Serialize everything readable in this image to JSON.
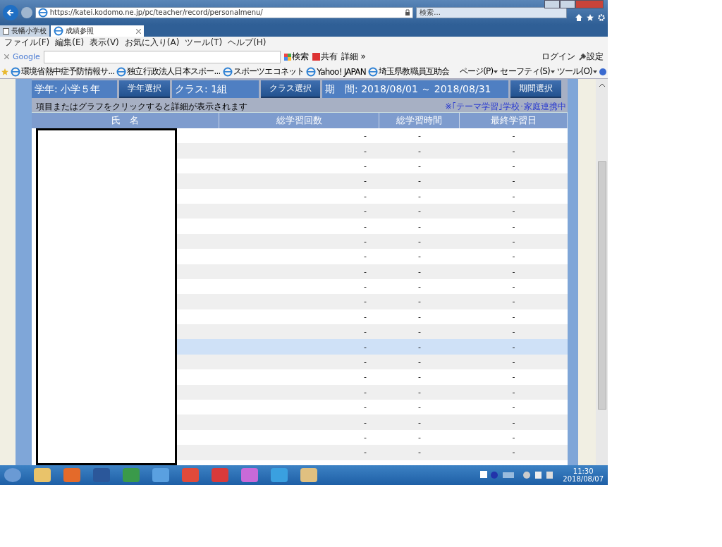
{
  "browser": {
    "address": "https://katei.kodomo.ne.jp/pc/teacher/record/personalmenu/",
    "search": {
      "placeholder": "検索..."
    },
    "tabs": [
      {
        "label": "長幡小学校",
        "selected": false
      },
      {
        "label": "成績参照",
        "selected": true
      }
    ],
    "menu": [
      "ファイル(F)",
      "編集(E)",
      "表示(V)",
      "お気に入り(A)",
      "ツール(T)",
      "ヘルプ(H)"
    ],
    "google_toolbar": {
      "logo": "Google",
      "search": "検索",
      "share": "共有",
      "more": "詳細 »",
      "login": "ログイン",
      "settings": "設定"
    },
    "favorites": [
      "環境省熱中症予防情報サ...",
      "独立行政法人日本スポー...",
      "スポーツエコネット",
      "Yahoo! JAPAN",
      "埼玉県教職員互助会"
    ],
    "command_bar": [
      "ページ(P)",
      "セーフティ(S)",
      "ツール(O)"
    ]
  },
  "page": {
    "grade": "学年: 小学５年",
    "grade_button": "学年選択",
    "class": "クラス: 1組",
    "class_button": "クラス選択",
    "period": "期　間: 2018/08/01 ～ 2018/08/31",
    "period_button": "期間選択",
    "hint": "項目またはグラフをクリックすると詳細が表示されます",
    "notice": "※｢テーマ学習｣学校･家庭連携中",
    "table": {
      "columns": [
        "氏　名",
        "総学習回数",
        "総学習時間",
        "最終学習日"
      ],
      "rows": [
        {
          "count": "-",
          "time": "-",
          "last": "-",
          "selected": false
        },
        {
          "count": "-",
          "time": "-",
          "last": "-",
          "selected": false
        },
        {
          "count": "-",
          "time": "-",
          "last": "-",
          "selected": false
        },
        {
          "count": "-",
          "time": "-",
          "last": "-",
          "selected": false
        },
        {
          "count": "-",
          "time": "-",
          "last": "-",
          "selected": false
        },
        {
          "count": "-",
          "time": "-",
          "last": "-",
          "selected": false
        },
        {
          "count": "-",
          "time": "-",
          "last": "-",
          "selected": false
        },
        {
          "count": "-",
          "time": "-",
          "last": "-",
          "selected": false
        },
        {
          "count": "-",
          "time": "-",
          "last": "-",
          "selected": false
        },
        {
          "count": "-",
          "time": "-",
          "last": "-",
          "selected": false
        },
        {
          "count": "-",
          "time": "-",
          "last": "-",
          "selected": false
        },
        {
          "count": "-",
          "time": "-",
          "last": "-",
          "selected": false
        },
        {
          "count": "-",
          "time": "-",
          "last": "-",
          "selected": false
        },
        {
          "count": "-",
          "time": "-",
          "last": "-",
          "selected": false
        },
        {
          "count": "-",
          "time": "-",
          "last": "-",
          "selected": true
        },
        {
          "count": "-",
          "time": "-",
          "last": "-",
          "selected": false
        },
        {
          "count": "-",
          "time": "-",
          "last": "-",
          "selected": false
        },
        {
          "count": "-",
          "time": "-",
          "last": "-",
          "selected": false
        },
        {
          "count": "-",
          "time": "-",
          "last": "-",
          "selected": false
        },
        {
          "count": "-",
          "time": "-",
          "last": "-",
          "selected": false
        },
        {
          "count": "-",
          "time": "-",
          "last": "-",
          "selected": false
        },
        {
          "count": "-",
          "time": "-",
          "last": "-",
          "selected": false
        }
      ]
    }
  },
  "taskbar": {
    "time": "11:30",
    "date": "2018/08/07"
  }
}
